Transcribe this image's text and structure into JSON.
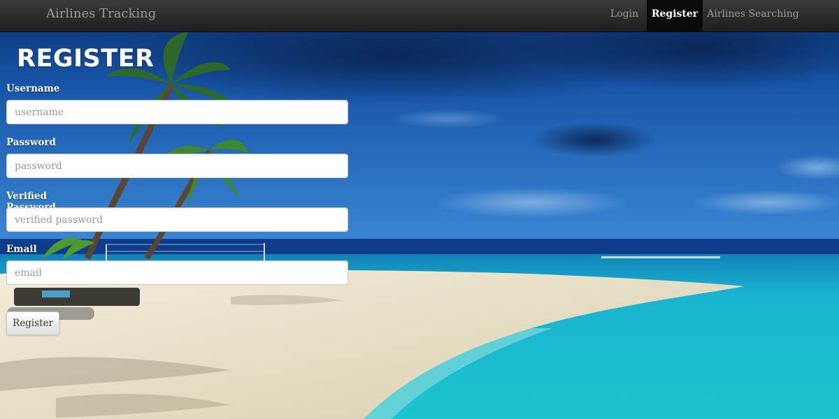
{
  "navbar": {
    "brand": "Airlines Tracking",
    "links": [
      {
        "label": "Login",
        "active": false
      },
      {
        "label": "Register",
        "active": true
      },
      {
        "label": "Airlines Searching",
        "active": false
      }
    ]
  },
  "form": {
    "title": "REGISTER",
    "fields": [
      {
        "label": "Username",
        "placeholder": "username",
        "value": ""
      },
      {
        "label": "Password",
        "placeholder": "password",
        "value": ""
      },
      {
        "label": "Verified Password",
        "placeholder": "verified password",
        "value": ""
      },
      {
        "label": "Email",
        "placeholder": "email",
        "value": ""
      }
    ],
    "submit_label": "Register"
  },
  "colors": {
    "navbar_bg": "#2b2b2b",
    "nav_active_bg": "#0a0a0a",
    "nav_text": "#9d9d9d",
    "sky": "#1b5fb5",
    "sea": "#17c6d4",
    "sand": "#e9e3cf"
  }
}
